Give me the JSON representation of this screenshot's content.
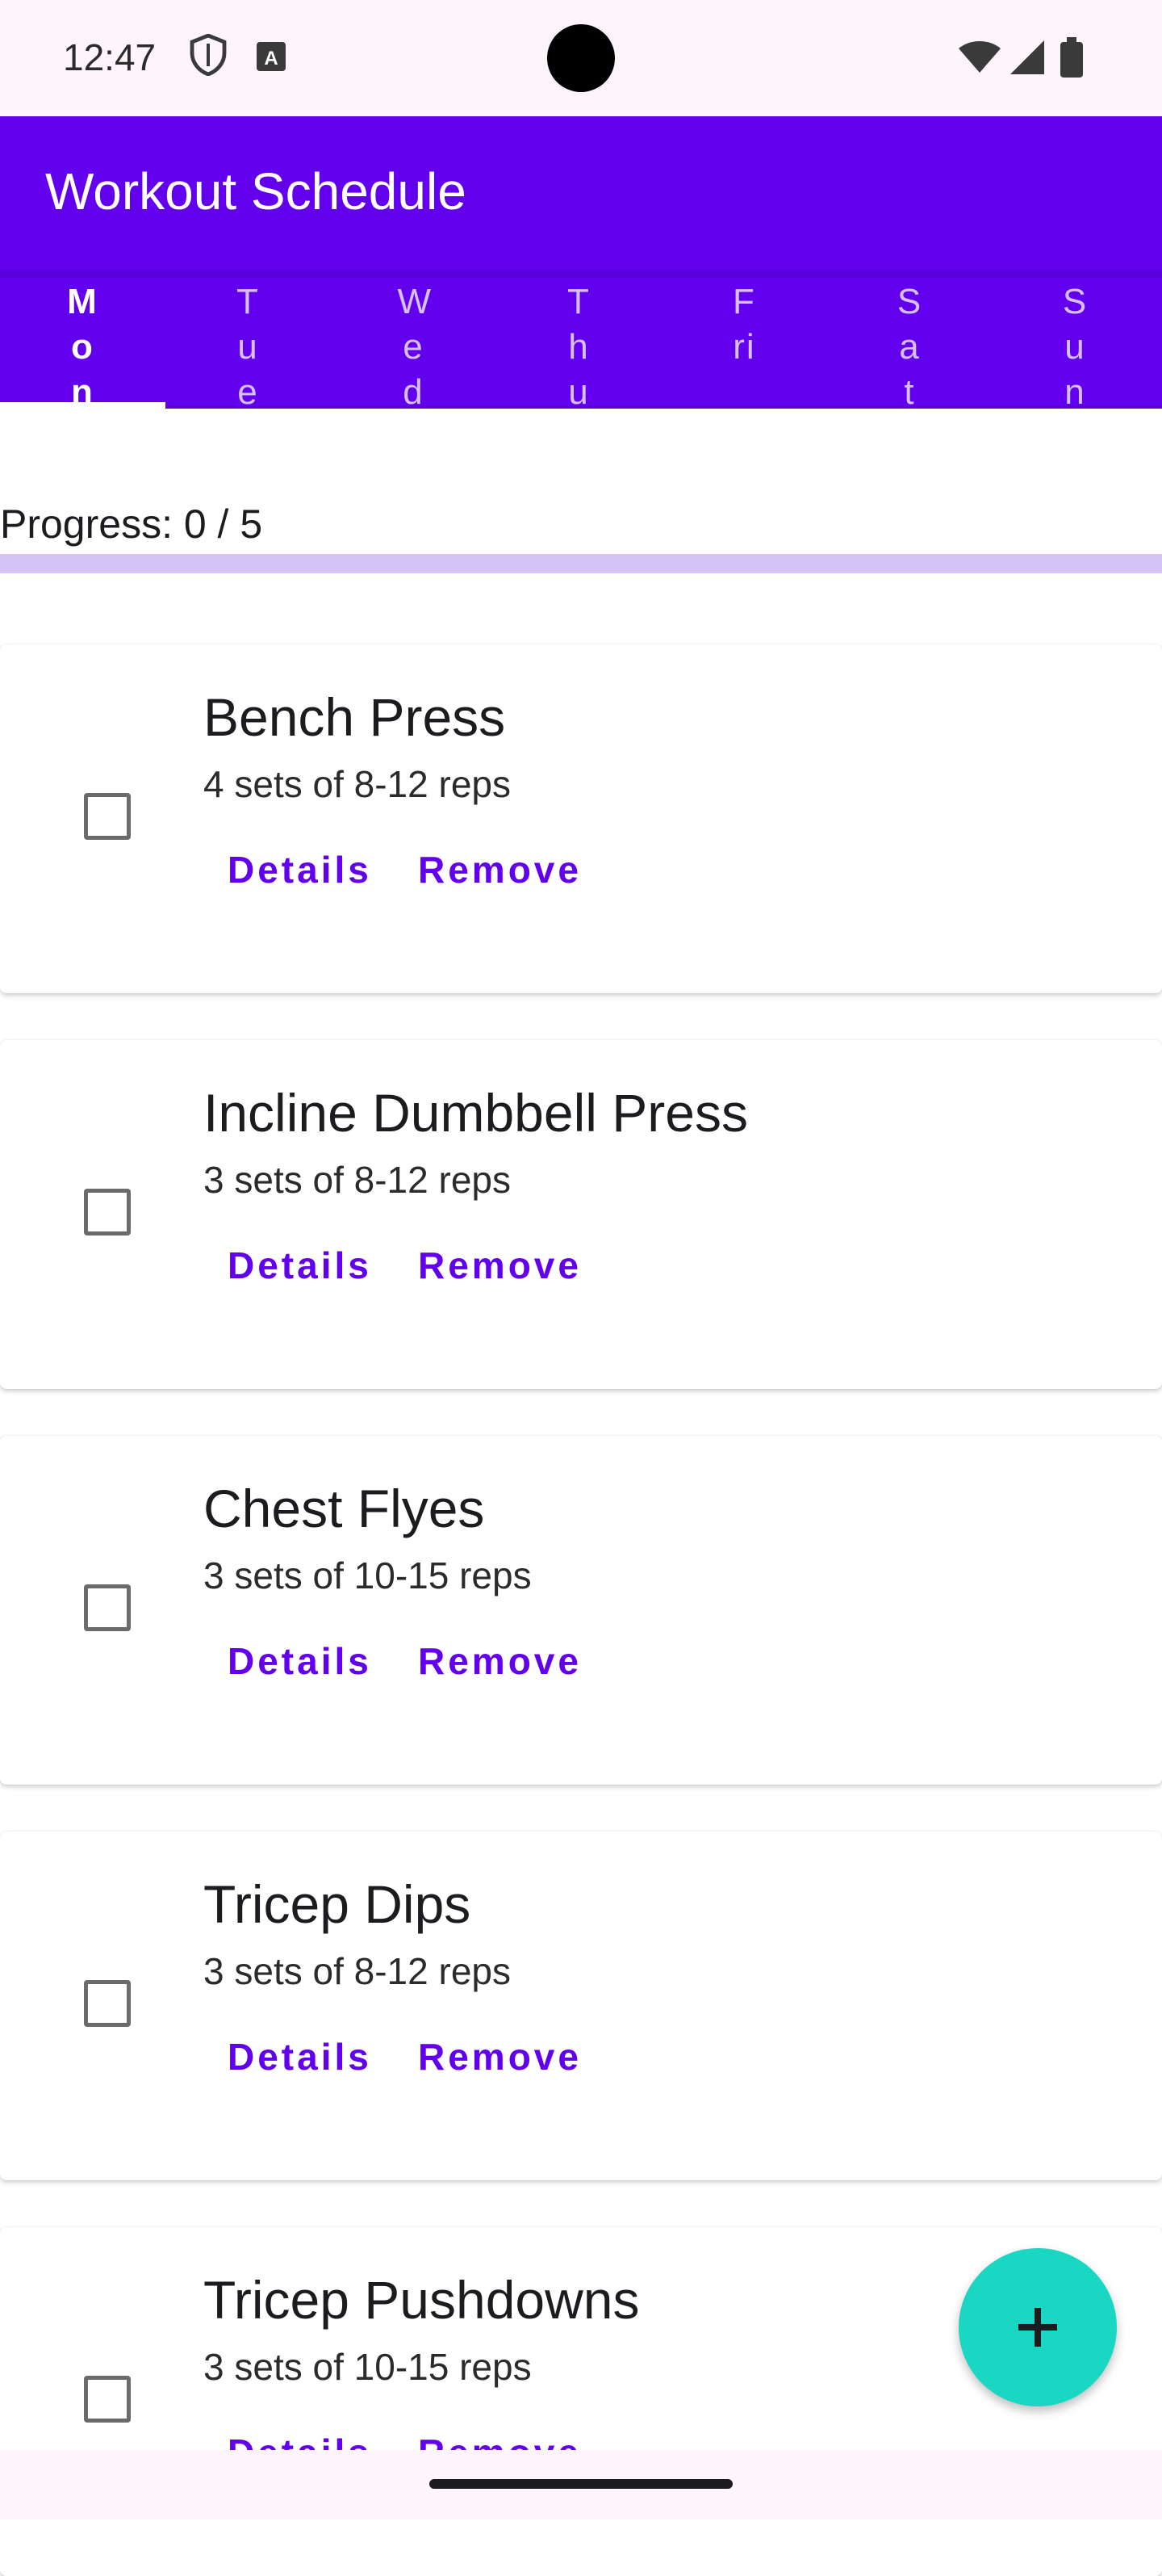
{
  "status_bar": {
    "time": "12:47",
    "left_icons": [
      "shield-icon",
      "keyboard-a-icon"
    ],
    "right_icons": [
      "wifi-icon",
      "signal-icon",
      "battery-icon"
    ]
  },
  "app_bar": {
    "title": "Workout Schedule"
  },
  "tabs": [
    {
      "label": "Mon",
      "active": true
    },
    {
      "label": "Tue",
      "active": false
    },
    {
      "label": "Wed",
      "active": false
    },
    {
      "label": "Thu",
      "active": false
    },
    {
      "label": "Fri",
      "active": false
    },
    {
      "label": "Sat",
      "active": false
    },
    {
      "label": "Sun",
      "active": false
    }
  ],
  "progress": {
    "text": "Progress: 0 / 5",
    "completed": 0,
    "total": 5
  },
  "exercises": [
    {
      "name": "Bench Press",
      "description": "4 sets of 8-12 reps",
      "checked": false
    },
    {
      "name": "Incline Dumbbell Press",
      "description": "3 sets of 8-12 reps",
      "checked": false
    },
    {
      "name": "Chest Flyes",
      "description": "3 sets of 10-15 reps",
      "checked": false
    },
    {
      "name": "Tricep Dips",
      "description": "3 sets of 8-12 reps",
      "checked": false
    },
    {
      "name": "Tricep Pushdowns",
      "description": "3 sets of 10-15 reps",
      "checked": false
    }
  ],
  "actions": {
    "details_label": "Details",
    "remove_label": "Remove"
  },
  "fab": {
    "icon": "plus-icon"
  },
  "colors": {
    "primary": "#6200EE",
    "fab": "#1AD7C4",
    "progress_track": "#D4C3F6"
  }
}
